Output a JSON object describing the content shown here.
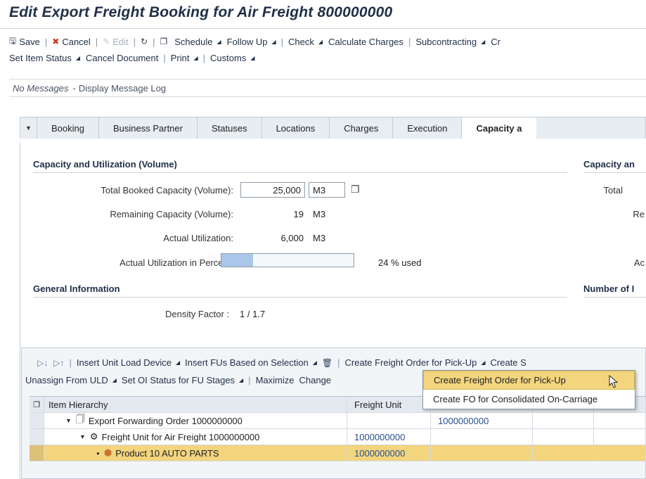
{
  "window": {
    "title": "Edit Export Freight Booking for Air Freight 800000000"
  },
  "toolbar": {
    "row1": [
      {
        "label": "Save",
        "icon": "save-icon",
        "dropdown": false,
        "disabled": false
      },
      {
        "label": "Cancel",
        "icon": "cancel-icon",
        "dropdown": false,
        "disabled": false
      },
      {
        "label": "Edit",
        "icon": "edit-icon",
        "dropdown": false,
        "disabled": true
      },
      {
        "label": "",
        "icon": "refresh-icon",
        "dropdown": false,
        "disabled": false
      },
      {
        "label": "",
        "icon": "copy-icon",
        "dropdown": false,
        "disabled": false
      },
      {
        "label": "Schedule",
        "dropdown": true
      },
      {
        "label": "Follow Up",
        "dropdown": true
      },
      {
        "label": "Check",
        "dropdown": true
      },
      {
        "label": "Calculate Charges",
        "dropdown": false
      },
      {
        "label": "Subcontracting",
        "dropdown": true
      },
      {
        "label": "Cr",
        "dropdown": false
      }
    ],
    "row2": [
      {
        "label": "Set Item Status",
        "dropdown": true
      },
      {
        "label": "Cancel Document",
        "dropdown": false
      },
      {
        "label": "Print",
        "dropdown": true
      },
      {
        "label": "Customs",
        "dropdown": true
      }
    ]
  },
  "messages": {
    "text": "No Messages",
    "link": "Display Message Log"
  },
  "tabs": [
    {
      "label": "Booking",
      "active": false
    },
    {
      "label": "Business Partner",
      "active": false
    },
    {
      "label": "Statuses",
      "active": false
    },
    {
      "label": "Locations",
      "active": false
    },
    {
      "label": "Charges",
      "active": false
    },
    {
      "label": "Execution",
      "active": false
    },
    {
      "label": "Capacity a",
      "active": true
    }
  ],
  "capacity": {
    "section_title": "Capacity and Utilization (Volume)",
    "section_title_right": "Capacity an",
    "total_booked_label": "Total Booked Capacity (Volume):",
    "total_booked_value": "25,000",
    "total_booked_unit": "M3",
    "remaining_label": "Remaining Capacity (Volume):",
    "remaining_value": "19",
    "remaining_unit": "M3",
    "actual_label": "Actual Utilization:",
    "actual_value": "6,000",
    "actual_unit": "M3",
    "percent_label": "Actual Utilization in Percent:",
    "percent_text": "24 % used",
    "percent_fraction": 0.24,
    "right_labels": [
      "Total",
      "Re",
      "Ac"
    ]
  },
  "general": {
    "section_title": "General Information",
    "section_title_right": "Number of I",
    "density_label": "Density Factor :",
    "density_value": "1 / 1.7"
  },
  "table_toolbar": {
    "row1": [
      {
        "label": "",
        "icon": "sort-ascending-icon"
      },
      {
        "label": "",
        "icon": "sort-descending-icon"
      },
      {
        "label": "Insert Unit Load Device",
        "dropdown": true
      },
      {
        "label": "Insert FUs Based on Selection",
        "dropdown": true
      },
      {
        "label": "",
        "icon": "delete-icon"
      },
      {
        "label": "Create Freight Order for Pick-Up",
        "dropdown": true
      },
      {
        "label": "Create S",
        "dropdown": false
      }
    ],
    "row2": [
      {
        "label": "Unassign From ULD",
        "dropdown": true
      },
      {
        "label": "Set OI Status for FU Stages",
        "dropdown": true
      },
      {
        "label": "Maximize",
        "dropdown": false
      },
      {
        "label": "Change",
        "dropdown": false
      }
    ]
  },
  "grid": {
    "columns": [
      "Item Hierarchy",
      "Freight Unit"
    ],
    "rows": [
      {
        "label": "Export Forwarding Order 1000000000",
        "icon": "document-icon",
        "level": 1,
        "node": "expanded",
        "freight_unit": "",
        "col3": "1000000000",
        "highlight": false
      },
      {
        "label": "Freight Unit for Air Freight 1000000000",
        "icon": "freight-unit-icon",
        "level": 2,
        "node": "expanded",
        "freight_unit": "1000000000",
        "col3": "",
        "highlight": false
      },
      {
        "label": "Product 10 AUTO PARTS",
        "icon": "product-icon",
        "level": 3,
        "node": "leaf",
        "freight_unit": "1000000000",
        "col3": "",
        "highlight": true
      }
    ]
  },
  "dropdown_menu": {
    "items": [
      "Create Freight Order for Pick-Up",
      "Create FO for Consolidated On-Carriage"
    ],
    "hovered_index": 0
  },
  "colors": {
    "title": "#1f2f47",
    "highlight": "#f3d57e",
    "progress_fill": "#a9c7e8",
    "link": "#2a4f8f"
  }
}
